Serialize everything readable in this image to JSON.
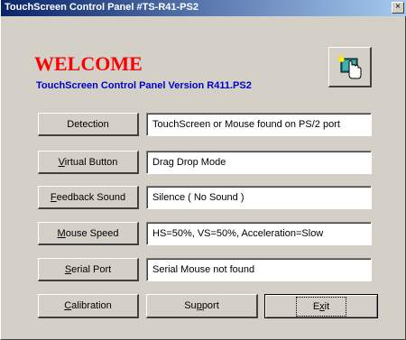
{
  "window": {
    "title": "TouchScreen Control Panel #TS-R41-PS2",
    "close_glyph": "×"
  },
  "header": {
    "welcome": "WELCOME",
    "version": "TouchScreen Control Panel Version R411.PS2",
    "welcome_color": "#ff0000",
    "version_color": "#0000cc",
    "icon": "touchscreen-hand-icon"
  },
  "rows": [
    {
      "button_label": "Detection",
      "value": "TouchScreen or Mouse found on PS/2 port"
    },
    {
      "button_label_underline": "V",
      "button_label_rest": "irtual Button",
      "value": "Drag Drop Mode"
    },
    {
      "button_label_underline": "F",
      "button_label_rest": "eedback Sound",
      "value": "Silence ( No Sound )"
    },
    {
      "button_label_underline": "M",
      "button_label_rest": "ouse Speed",
      "value": "HS=50%, VS=50%, Acceleration=Slow"
    },
    {
      "button_label_underline": "S",
      "button_label_rest": "erial Port",
      "value": "Serial Mouse not found"
    }
  ],
  "bottom_buttons": {
    "calibration_u": "C",
    "calibration_rest": "alibration",
    "support_pre": "Su",
    "support_u": "p",
    "support_rest": "port",
    "exit_pre": "E",
    "exit_u": "x",
    "exit_rest": "it"
  }
}
